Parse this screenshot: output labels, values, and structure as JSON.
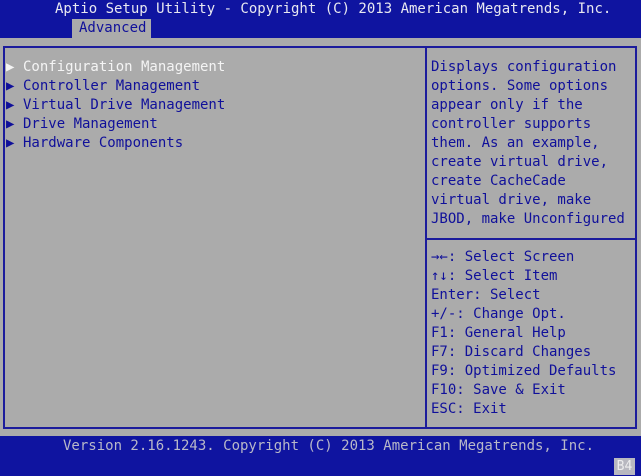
{
  "header": {
    "title": "Aptio Setup Utility - Copyright (C) 2013 American Megatrends, Inc.",
    "tab": "Advanced"
  },
  "menu": {
    "items": [
      {
        "label": "Configuration Management",
        "selected": true
      },
      {
        "label": "Controller Management"
      },
      {
        "label": "Virtual Drive Management"
      },
      {
        "label": "Drive Management"
      },
      {
        "label": "Hardware Components"
      }
    ]
  },
  "help": {
    "lines": [
      "Displays configuration",
      "options. Some options",
      "appear only if the",
      "controller supports",
      "them. As an example,",
      "create virtual drive,",
      "create CacheCade",
      "virtual drive, make",
      "JBOD, make Unconfigured"
    ]
  },
  "keys": [
    "→←: Select Screen",
    "↑↓: Select Item",
    "Enter: Select",
    "+/-: Change Opt.",
    "F1: General Help",
    "F7: Discard Changes",
    "F9: Optimized Defaults",
    "F10: Save & Exit",
    "ESC: Exit"
  ],
  "footer": {
    "version": "Version 2.16.1243. Copyright (C) 2013 American Megatrends, Inc.",
    "code": "B4"
  }
}
